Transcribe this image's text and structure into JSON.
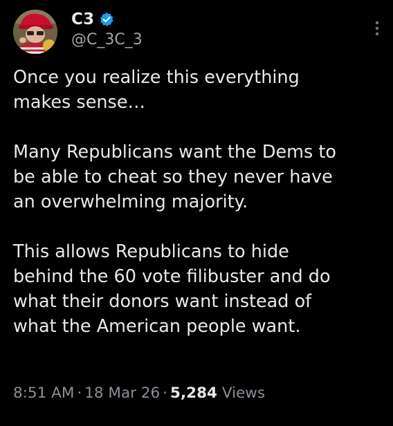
{
  "author": {
    "display_name": "C3",
    "handle": "@C_3C_3",
    "verified": true,
    "badge_color": "#1d9bf0",
    "avatar": "person-in-red-hat-avatar"
  },
  "tweet": {
    "paragraphs": [
      "Once you realize this everything\nmakes sense…",
      "Many Republicans want the Dems to\nbe able to cheat so they never have\nan overwhelming majority.",
      "This allows Republicans to hide\nbehind the 60 vote filibuster and do\nwhat their donors want instead of\nwhat the American people want."
    ]
  },
  "meta": {
    "time": "8:51 AM",
    "separator": "·",
    "date": "18 Mar 26",
    "views_count": "5,284",
    "views_label": "Views"
  },
  "icons": {
    "more": "more-vertical-icon",
    "verified": "verified-badge-icon"
  },
  "colors": {
    "background": "#000000",
    "primary_text": "#e7e9ea",
    "secondary_text": "#8b9096"
  }
}
